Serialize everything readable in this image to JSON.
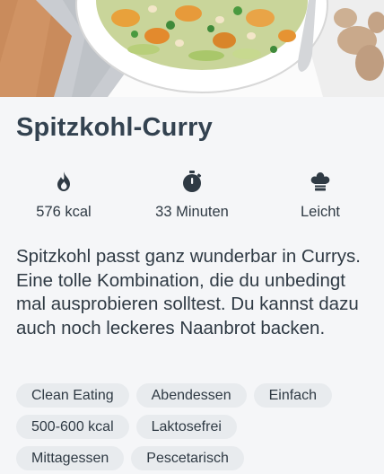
{
  "recipe": {
    "title": "Spitzkohl-Curry",
    "stats": [
      {
        "icon": "flame-icon",
        "label": "576 kcal"
      },
      {
        "icon": "stopwatch-icon",
        "label": "33 Minuten"
      },
      {
        "icon": "chef-hat-icon",
        "label": "Leicht"
      }
    ],
    "description": "Spitzkohl passt ganz wunderbar in Currys. Eine tolle Kombination, die du unbedingt mal ausprobieren solltest. Du kannst dazu auch noch leckeres Naanbrot backen.",
    "tags": [
      [
        "Clean Eating",
        "Abendessen",
        "Einfach"
      ],
      [
        "500-600 kcal",
        "Laktosefrei"
      ],
      [
        "Mittagessen",
        "Pescetarisch"
      ]
    ]
  },
  "colors": {
    "background": "#f5f6f8",
    "text": "#2f3a44",
    "tag_bg": "#e8ebee"
  }
}
